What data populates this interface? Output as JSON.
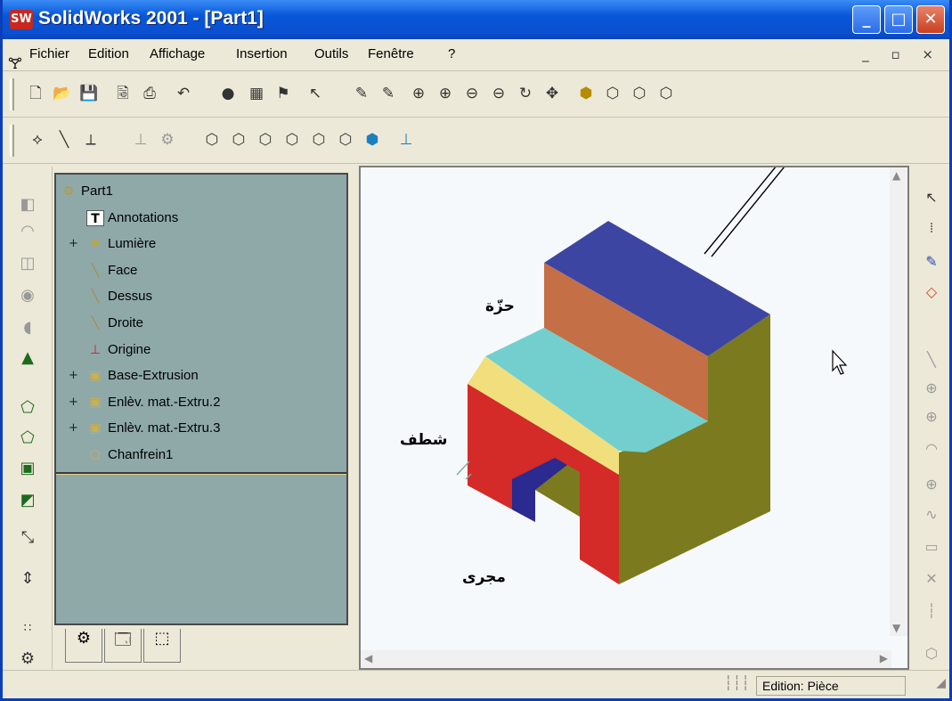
{
  "title": {
    "logo": "SW",
    "text": "SolidWorks 2001 - [Part1]"
  },
  "window_buttons": {
    "minimize": "_",
    "maximize": "□",
    "close": "✕"
  },
  "menu": [
    "Fichier",
    "Edition",
    "Affichage",
    "Insertion",
    "Outils",
    "Fenêtre",
    "?"
  ],
  "mdi_buttons": "_ ▫ ×",
  "tree": {
    "items": [
      {
        "label": "Part1",
        "icon": "part-icon",
        "expand": ""
      },
      {
        "label": "Annotations",
        "icon": "annotations-icon",
        "expand": ""
      },
      {
        "label": "Lumière",
        "icon": "light-icon",
        "expand": "+"
      },
      {
        "label": "Face",
        "icon": "plane-icon",
        "expand": ""
      },
      {
        "label": "Dessus",
        "icon": "plane-icon",
        "expand": ""
      },
      {
        "label": "Droite",
        "icon": "plane-icon",
        "expand": ""
      },
      {
        "label": "Origine",
        "icon": "origin-icon",
        "expand": ""
      },
      {
        "label": "Base-Extrusion",
        "icon": "extrude-icon",
        "expand": "+"
      },
      {
        "label": "Enlèv. mat.-Extru.2",
        "icon": "cut-extrude-icon",
        "expand": "+"
      },
      {
        "label": "Enlèv. mat.-Extru.3",
        "icon": "cut-extrude-icon",
        "expand": "+"
      },
      {
        "label": "Chanfrein1",
        "icon": "chamfer-icon",
        "expand": ""
      }
    ]
  },
  "annotations": {
    "rib": "حزّة",
    "chamfer": "شطف",
    "groove": "مجرى"
  },
  "status": {
    "text": "Edition: Pièce"
  },
  "colors": {
    "top_face": "#3d45a3",
    "orange_face": "#c46f45",
    "cyan_face": "#72cfce",
    "yellow_chamfer": "#f1df7e",
    "front_red": "#d42a28",
    "right_olive": "#7b7a1f",
    "groove_blue": "#2a2a90"
  }
}
